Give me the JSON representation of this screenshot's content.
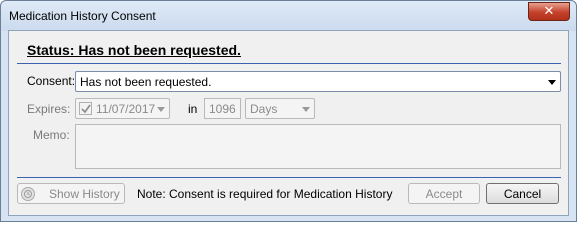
{
  "window": {
    "title": "Medication History Consent",
    "close_glyph": "✕"
  },
  "status": {
    "text": "Status: Has not been requested."
  },
  "consent": {
    "label": "Consent:",
    "value": "Has not been requested."
  },
  "expires": {
    "label": "Expires:",
    "checked": true,
    "date": "11/07/2017",
    "in_label": "in",
    "amount": "1096",
    "unit": "Days"
  },
  "memo": {
    "label": "Memo:",
    "value": ""
  },
  "footer": {
    "show_history_label": "Show History",
    "note": "Note: Consent is required for Medication History",
    "accept_label": "Accept",
    "cancel_label": "Cancel"
  },
  "icons": {
    "close": "close-icon",
    "checkbox": "checkmark-icon",
    "history": "history-icon",
    "dropdown": "chevron-down-icon"
  },
  "colors": {
    "window_frame": "#d6e3f2",
    "client_bg": "#f0f0f0",
    "separator": "#3a62b0",
    "close_button": "#c4412b"
  }
}
